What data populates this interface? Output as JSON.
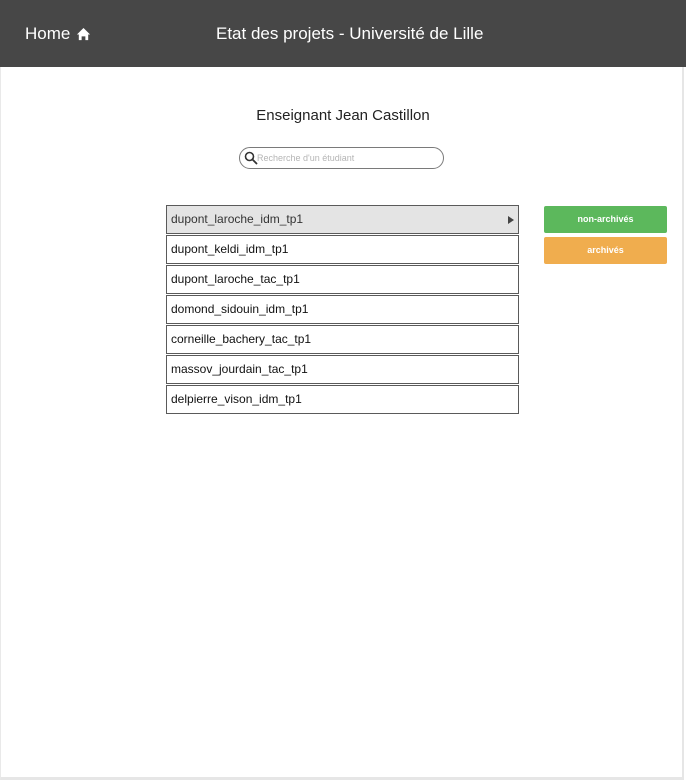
{
  "header": {
    "home_label": "Home",
    "title": "Etat des projets - Université de Lille"
  },
  "teacher": {
    "title": "Enseignant Jean Castillon"
  },
  "search": {
    "placeholder": "Recherche d'un étudiant",
    "value": ""
  },
  "projects": [
    "dupont_laroche_idm_tp1",
    "dupont_keldi_idm_tp1",
    "dupont_laroche_tac_tp1",
    "domond_sidouin_idm_tp1",
    "corneille_bachery_tac_tp1",
    "massov_jourdain_tac_tp1",
    "delpierre_vison_idm_tp1"
  ],
  "selected_index": 0,
  "filters": {
    "non_archived_label": "non-archivés",
    "archived_label": "archivés"
  },
  "colors": {
    "header_bg": "#474747",
    "non_archived": "#5cb85c",
    "archived": "#f0ad4e"
  },
  "icons": {
    "home": "home-icon",
    "search": "search-icon",
    "selected_arrow": "triangle-right-icon"
  }
}
